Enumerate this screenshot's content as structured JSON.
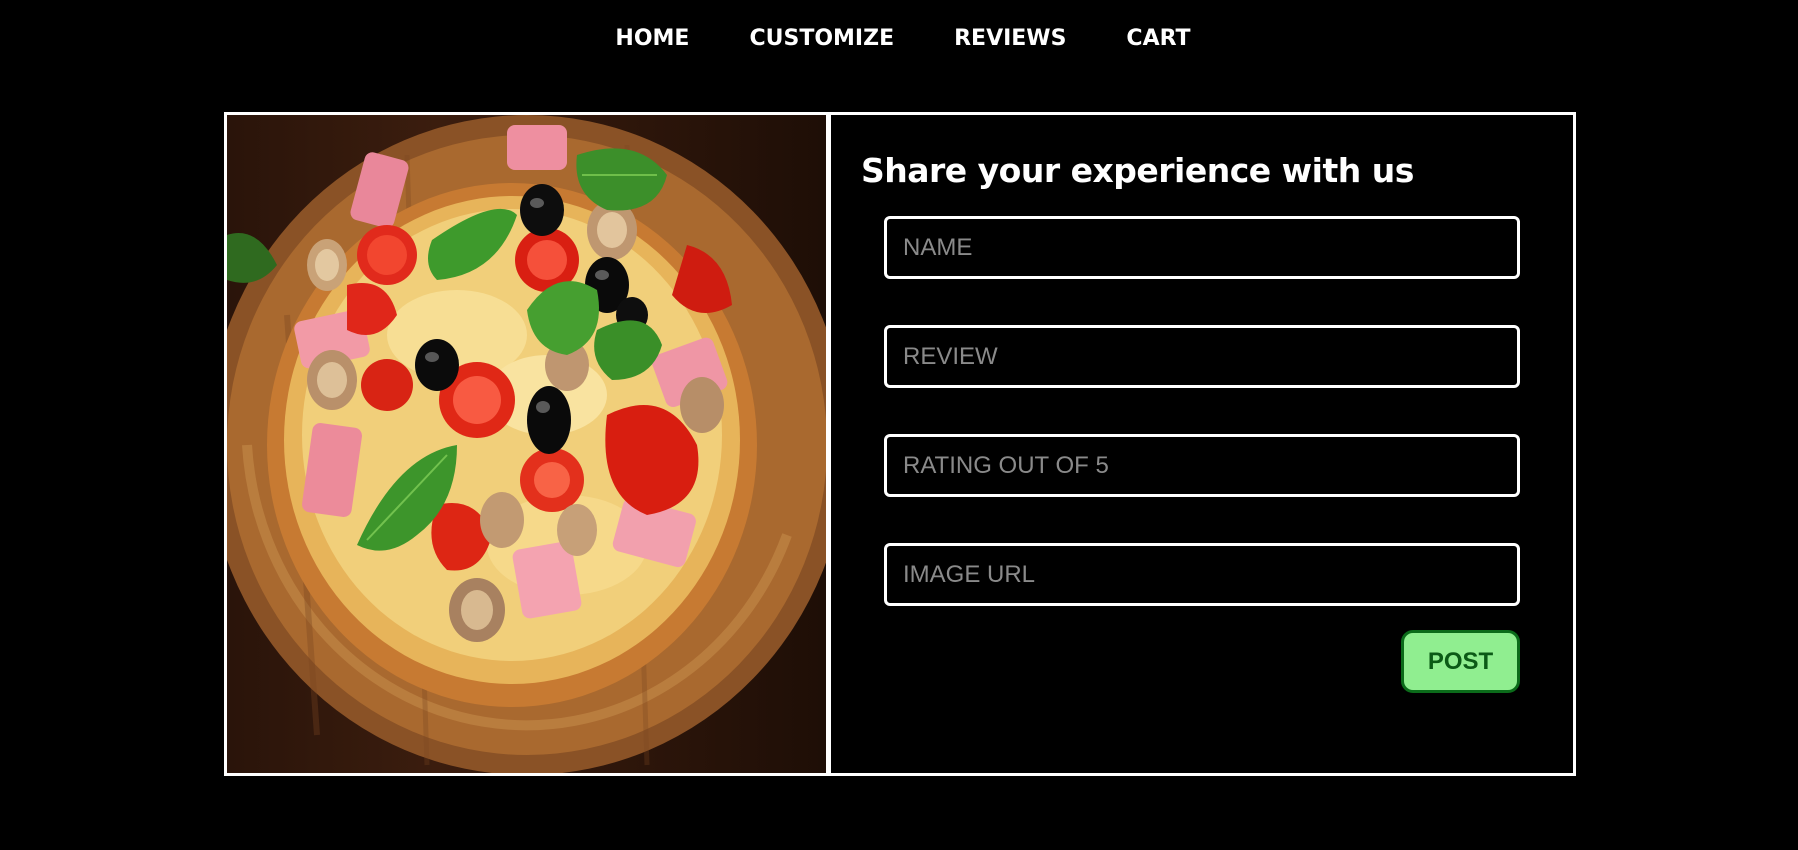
{
  "nav": {
    "items": [
      {
        "label": "HOME"
      },
      {
        "label": "CUSTOMIZE"
      },
      {
        "label": "REVIEWS"
      },
      {
        "label": "CART"
      }
    ]
  },
  "review_form": {
    "title": "Share your experience with us",
    "name_placeholder": "NAME",
    "review_placeholder": "REVIEW",
    "rating_placeholder": "RATING OUT OF 5",
    "image_url_placeholder": "IMAGE URL",
    "post_label": "POST"
  },
  "colors": {
    "background": "#000000",
    "border": "#ffffff",
    "post_button_bg": "#90ee90",
    "post_button_border": "#0b6b1a",
    "post_button_text": "#0b5a16",
    "placeholder": "#8a8a8a"
  },
  "image": {
    "subject": "pizza with basil, olives, tomatoes, ham, mushrooms on wooden board"
  }
}
